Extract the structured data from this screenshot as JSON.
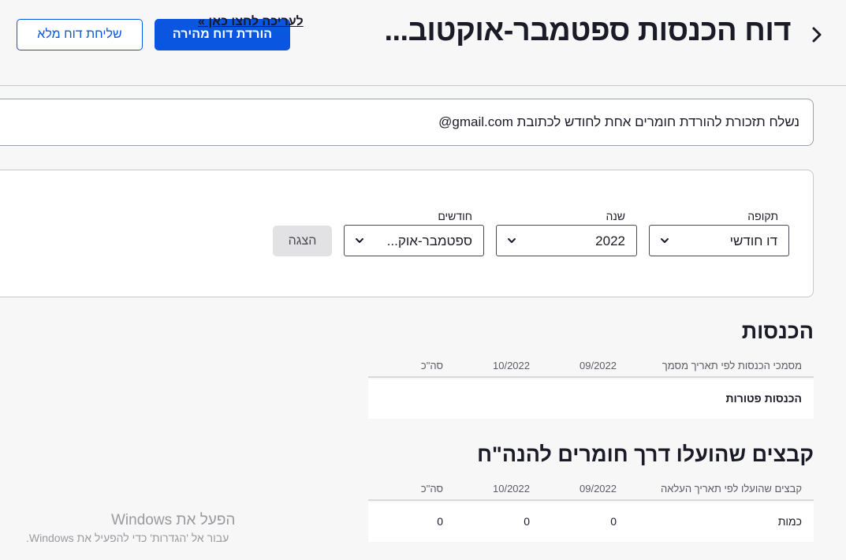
{
  "header": {
    "title": "דוח הכנסות ספטמבר-אוקטוב...",
    "primary_button": "הורדת דוח מהירה",
    "secondary_button": "שליחת דוח מלא",
    "back_icon": "chevron-right-icon"
  },
  "notice": {
    "text": "נשלח תזכורת להורדת חומרים אחת לחודש לכתובת gmail.com@",
    "link": "לעריכה לחצו כאן »"
  },
  "filters": {
    "period_label": "תקופה",
    "period_value": "דו חודשי",
    "year_label": "שנה",
    "year_value": "2022",
    "months_label": "חודשים",
    "months_value": "ספטמבר-אוק...",
    "show_button": "הצגה"
  },
  "income": {
    "title": "הכנסות",
    "columns": [
      "מסמכי הכנסות לפי תאריך מסמך",
      "09/2022",
      "10/2022",
      "סה\"כ"
    ],
    "rows": [
      {
        "label": "הכנסות פטורות"
      }
    ]
  },
  "uploads": {
    "title": "קבצים שהועלו דרך חומרים להנה\"ח",
    "columns": [
      "קבצים שהועלו לפי תאריך העלאה",
      "09/2022",
      "10/2022",
      "סה\"כ"
    ],
    "rows": [
      {
        "label": "כמות",
        "sep": "0",
        "oct": "0",
        "total": "0"
      }
    ]
  },
  "watermark": {
    "title": "הפעל את Windows",
    "subtitle": "עבור אל 'הגדרות' כדי להפעיל את Windows."
  },
  "colors": {
    "accent": "#0a56e0",
    "text": "#1b1b28",
    "background": "#f7f7f7"
  }
}
